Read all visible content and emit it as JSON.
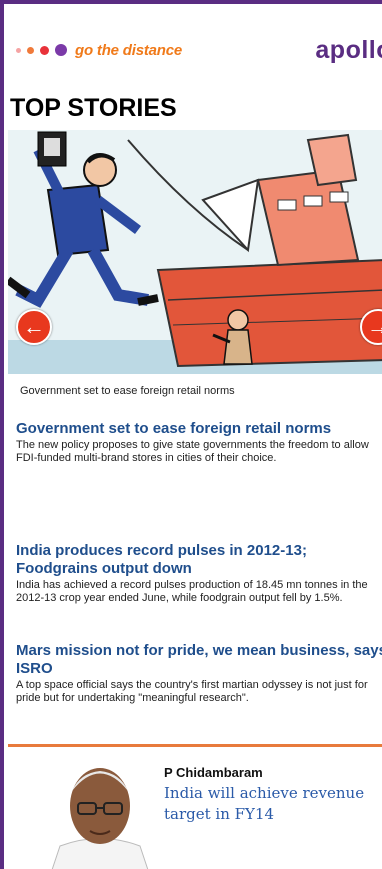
{
  "ad": {
    "tagline": "go the distance",
    "brand": "apollo",
    "colors": {
      "orange": "#f07a1a",
      "purple": "#5a2d82"
    }
  },
  "section": {
    "title": "TOP STORIES"
  },
  "slider": {
    "caption": "Government set to ease foreign retail norms",
    "prev_icon": "arrow-left-icon",
    "next_icon": "arrow-right-icon",
    "prev_glyph": "←",
    "next_glyph": "→"
  },
  "stories": [
    {
      "headline": "Government set to ease foreign retail norms",
      "summary": "The new policy proposes to give state governments the freedom to allow FDI-funded multi-brand stores in cities of their choice."
    },
    {
      "headline": "India produces record pulses in 2012-13; Foodgrains output down",
      "summary": "India has achieved a record pulses production of 18.45 mn tonnes in the 2012-13 crop year ended June, while foodgrain output fell by 1.5%."
    },
    {
      "headline": "Mars mission not for pride, we mean business, says ISRO",
      "summary": "A top space official says the country's first martian odyssey is not just for pride but for undertaking \"meaningful research\"."
    }
  ],
  "quote": {
    "name": "P Chidambaram",
    "text": "India will achieve revenue target in FY14"
  }
}
